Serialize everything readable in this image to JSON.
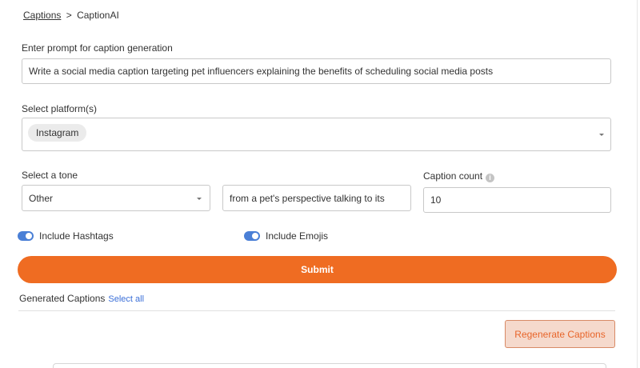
{
  "breadcrumb": {
    "parent": "Captions",
    "separator": ">",
    "current": "CaptionAI"
  },
  "prompt": {
    "label": "Enter prompt for caption generation",
    "value": "Write a social media caption targeting pet influencers explaining the benefits of scheduling social media posts"
  },
  "platform": {
    "label": "Select platform(s)",
    "selected": [
      "Instagram"
    ]
  },
  "tone": {
    "label": "Select a tone",
    "selected": "Other",
    "custom_value": "from a pet's perspective talking to its"
  },
  "caption_count": {
    "label": "Caption count",
    "value": "10",
    "info_icon": "info-icon"
  },
  "toggles": {
    "hashtags": {
      "label": "Include Hashtags",
      "on": true
    },
    "emojis": {
      "label": "Include Emojis",
      "on": true
    }
  },
  "submit_label": "Submit",
  "generated": {
    "title": "Generated Captions",
    "select_all": "Select all",
    "regenerate_label": "Regenerate Captions"
  },
  "colors": {
    "accent": "#ef6c22",
    "toggle": "#4a7fd6",
    "link": "#3b6fd8"
  }
}
